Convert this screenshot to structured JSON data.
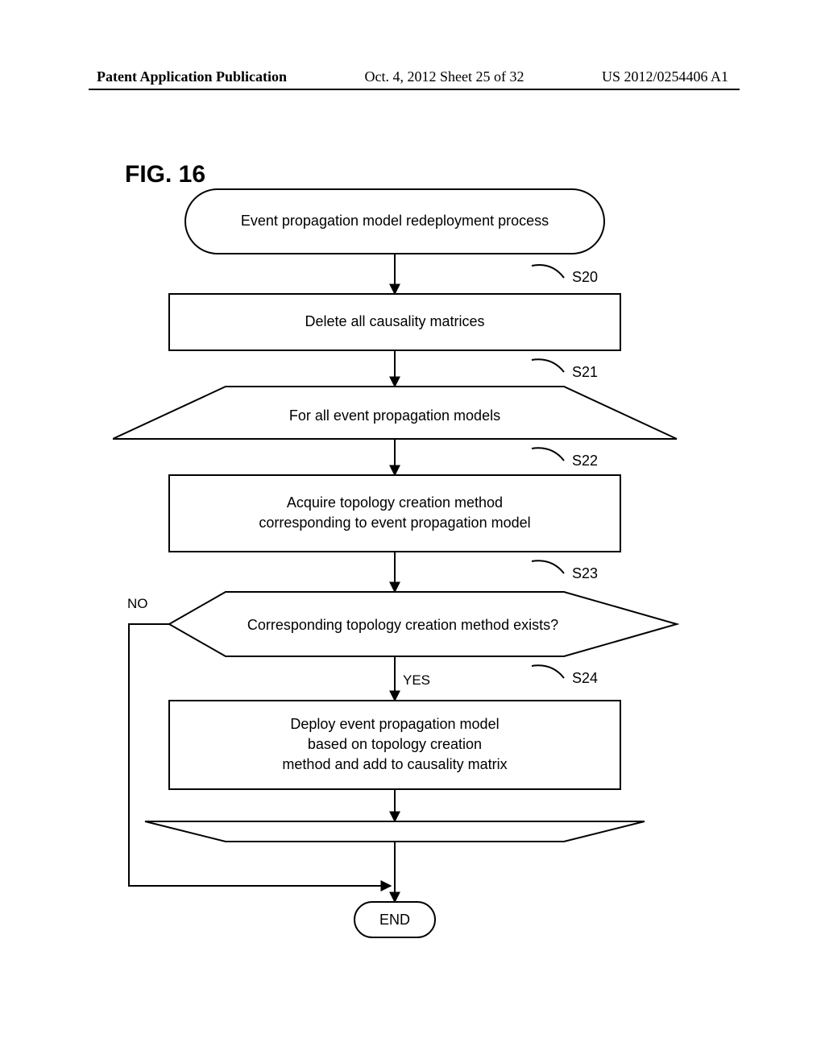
{
  "header": {
    "left": "Patent Application Publication",
    "center": "Oct. 4, 2012  Sheet 25 of 32",
    "right": "US 2012/0254406 A1"
  },
  "figure_label": "FIG. 16",
  "nodes": {
    "start": "Event propagation model redeployment process",
    "s20": "Delete all causality matrices",
    "s21": "For all event propagation models",
    "s22_l1": "Acquire topology creation method",
    "s22_l2": "corresponding to event propagation model",
    "s23": "Corresponding topology creation method exists?",
    "s24_l1": "Deploy event propagation model",
    "s24_l2": "based on topology creation",
    "s24_l3": "method and add to causality matrix",
    "end": "END"
  },
  "step_labels": {
    "s20": "S20",
    "s21": "S21",
    "s22": "S22",
    "s23": "S23",
    "s24": "S24"
  },
  "branches": {
    "no": "NO",
    "yes": "YES"
  }
}
